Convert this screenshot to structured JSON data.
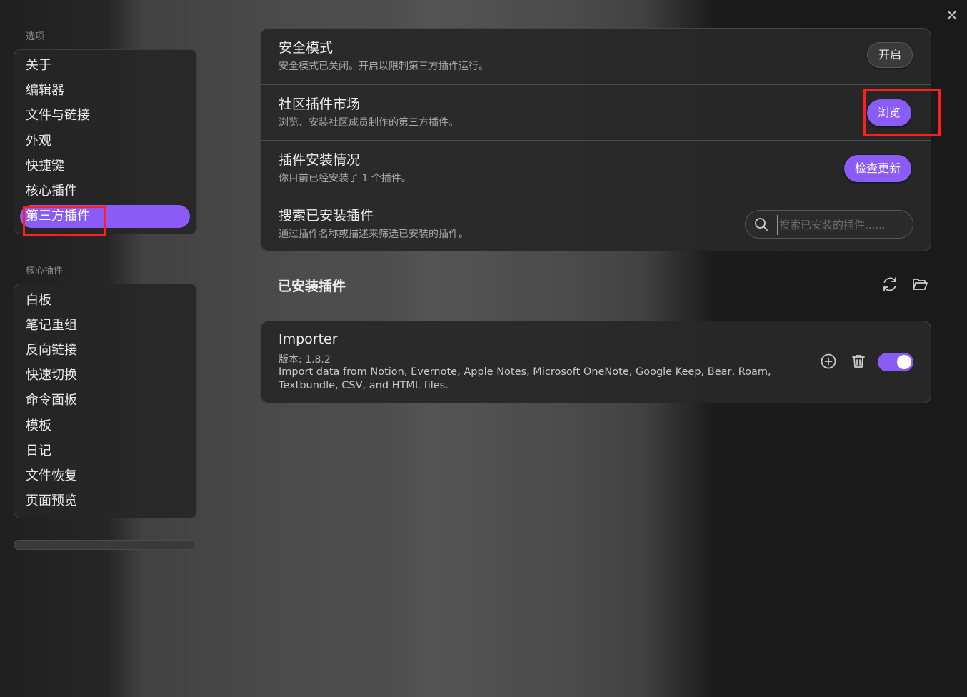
{
  "sidebar": {
    "options_label": "选项",
    "options_items": [
      {
        "label": "关于"
      },
      {
        "label": "编辑器"
      },
      {
        "label": "文件与链接"
      },
      {
        "label": "外观"
      },
      {
        "label": "快捷键"
      },
      {
        "label": "核心插件"
      },
      {
        "label": "第三方插件",
        "active": true
      }
    ],
    "core_label": "核心插件",
    "core_items": [
      {
        "label": "白板"
      },
      {
        "label": "笔记重组"
      },
      {
        "label": "反向链接"
      },
      {
        "label": "快速切换"
      },
      {
        "label": "命令面板"
      },
      {
        "label": "模板"
      },
      {
        "label": "日记"
      },
      {
        "label": "文件恢复"
      },
      {
        "label": "页面预览"
      }
    ]
  },
  "settings": {
    "safe_mode": {
      "title": "安全模式",
      "desc": "安全模式已关闭。开启以限制第三方插件运行。",
      "button": "开启"
    },
    "community": {
      "title": "社区插件市场",
      "desc": "浏览、安装社区成员制作的第三方插件。",
      "button": "浏览"
    },
    "installed_status": {
      "title": "插件安装情况",
      "desc": "你目前已经安装了 1 个插件。",
      "button": "检查更新"
    },
    "search": {
      "title": "搜索已安装插件",
      "desc": "通过插件名称或描述来筛选已安装的插件。",
      "placeholder": "搜索已安装的插件......",
      "value": ""
    }
  },
  "installed": {
    "title": "已安装插件",
    "plugins": [
      {
        "name": "Importer",
        "version": "版本: 1.8.2",
        "desc": "Import data from Notion, Evernote, Apple Notes, Microsoft OneNote, Google Keep, Bear, Roam, Textbundle, CSV, and HTML files.",
        "enabled": true
      }
    ]
  },
  "colors": {
    "accent": "#8a5cf5",
    "highlight": "#ff1f1f"
  }
}
